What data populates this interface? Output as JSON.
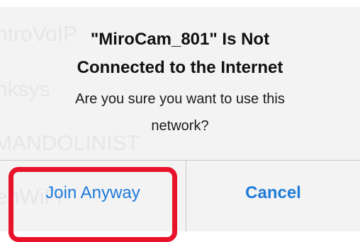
{
  "background_network_names": [
    "ntroVoIP",
    "nksys",
    "MANDOLINIST",
    "enWiFi"
  ],
  "alert": {
    "title_line1": "\"MiroCam_801\" Is Not",
    "title_line2": "Connected to the Internet",
    "message_line1": "Are you sure you want to use this",
    "message_line2": "network?",
    "join_button_label": "Join Anyway",
    "cancel_button_label": "Cancel"
  },
  "colors": {
    "button_text": "#1e7bd8",
    "highlight_border": "#e8132b",
    "alert_background": "#f3f3f4"
  }
}
